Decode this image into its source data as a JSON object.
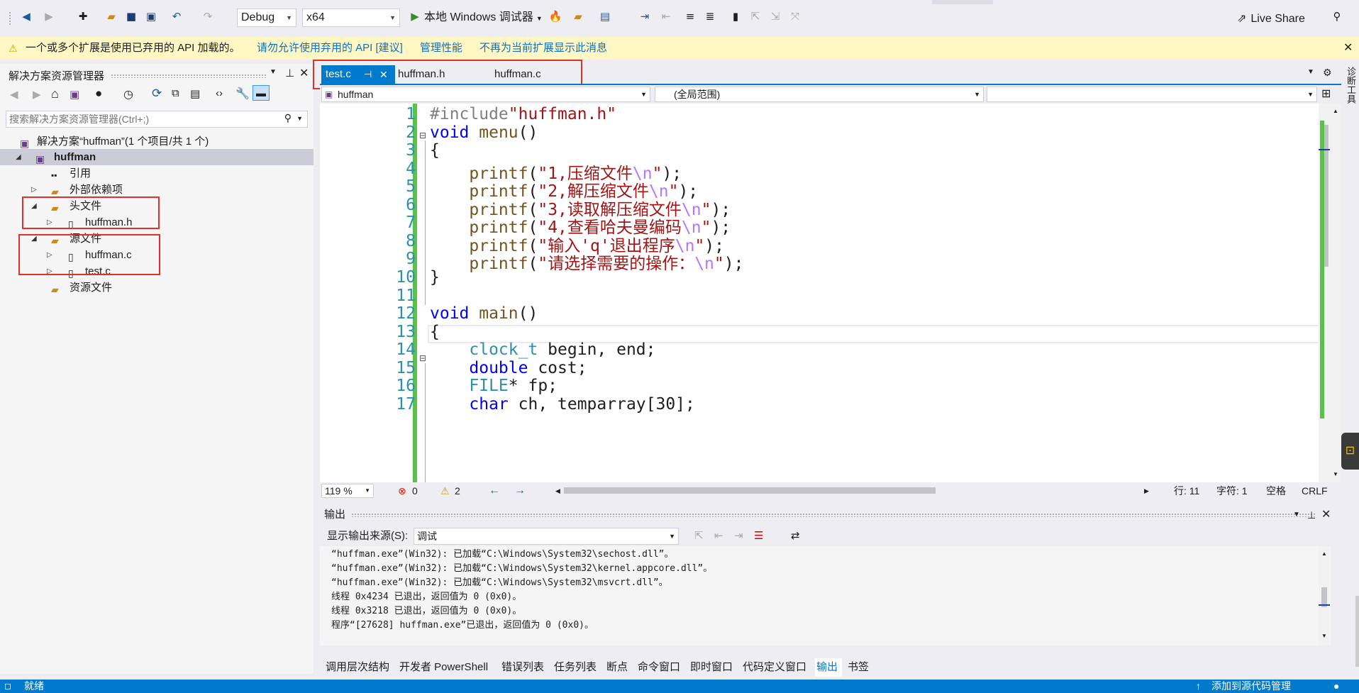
{
  "toolbar": {
    "config": "Debug",
    "platform": "x64",
    "run_label": "本地 Windows 调试器",
    "live_share": "Live Share"
  },
  "infobar": {
    "message": "一个或多个扩展是使用已弃用的 API 加载的。",
    "link1": "请勿允许使用弃用的 API [建议]",
    "link2": "管理性能",
    "link3": "不再为当前扩展显示此消息"
  },
  "solution_explorer": {
    "title": "解决方案资源管理器",
    "search_placeholder": "搜索解决方案资源管理器(Ctrl+;)",
    "solution": "解决方案“huffman”(1 个项目/共 1 个)",
    "project": "huffman",
    "items": [
      {
        "label": "引用"
      },
      {
        "label": "外部依赖项"
      },
      {
        "label": "头文件"
      },
      {
        "label": "huffman.h"
      },
      {
        "label": "源文件"
      },
      {
        "label": "huffman.c"
      },
      {
        "label": "test.c"
      },
      {
        "label": "资源文件"
      }
    ]
  },
  "editor": {
    "tabs": [
      {
        "label": "test.c",
        "active": true
      },
      {
        "label": "huffman.h"
      },
      {
        "label": "huffman.c"
      }
    ],
    "nav_project": "huffman",
    "nav_scope": "(全局范围)",
    "zoom": "119 %",
    "errors": "0",
    "warnings": "2",
    "line": "行: 11",
    "char": "字符: 1",
    "space": "空格",
    "eol": "CRLF",
    "line_numbers": [
      "1",
      "2",
      "3",
      "4",
      "5",
      "6",
      "7",
      "8",
      "9",
      "10",
      "11",
      "12",
      "13",
      "14",
      "15",
      "16",
      "17"
    ]
  },
  "output": {
    "title": "输出",
    "source_label": "显示输出来源(S):",
    "source_value": "调试",
    "lines": [
      "“huffman.exe”(Win32): 已加载“C:\\Windows\\System32\\sechost.dll”。",
      "“huffman.exe”(Win32): 已加载“C:\\Windows\\System32\\kernel.appcore.dll”。",
      "“huffman.exe”(Win32): 已加载“C:\\Windows\\System32\\msvcrt.dll”。",
      "线程 0x4234 已退出，返回值为 0 (0x0)。",
      "线程 0x3218 已退出，返回值为 0 (0x0)。",
      "程序“[27628] huffman.exe”已退出，返回值为 0 (0x0)。"
    ]
  },
  "bottom_tabs": [
    "调用层次结构",
    "开发者 PowerShell",
    "错误列表",
    "任务列表",
    "断点",
    "命令窗口",
    "即时窗口",
    "代码定义窗口",
    "输出",
    "书签"
  ],
  "status": {
    "ready": "就绪",
    "source_control": "添加到源代码管理"
  },
  "side_tab": "诊断工具"
}
